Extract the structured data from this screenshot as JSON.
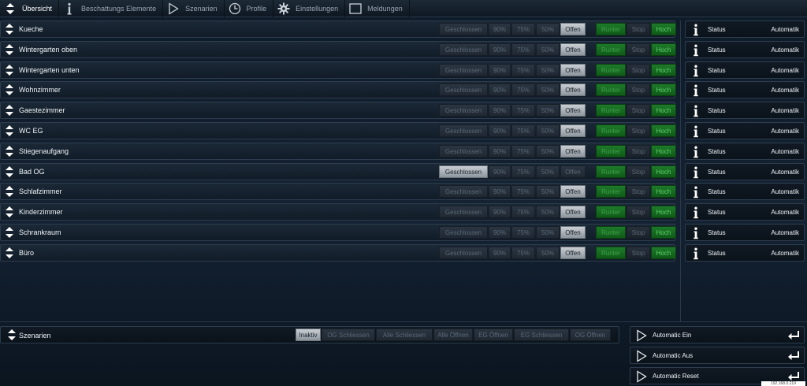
{
  "nav": {
    "items": [
      {
        "label": "Übersicht",
        "icon": "up-down-arrows-icon",
        "active": true
      },
      {
        "label": "Beschattungs Elemente",
        "icon": "info-icon",
        "active": false
      },
      {
        "label": "Szenarien",
        "icon": "play-icon",
        "active": false
      },
      {
        "label": "Profile",
        "icon": "clock-icon",
        "active": false
      },
      {
        "label": "Einstellungen",
        "icon": "gear-icon",
        "active": false
      },
      {
        "label": "Meldungen",
        "icon": "monitor-icon",
        "active": false
      }
    ]
  },
  "position_buttons": [
    "Geschlossen",
    "90%",
    "75%",
    "50%",
    "Offen"
  ],
  "move_buttons": [
    "Runter",
    "Stop",
    "Hoch"
  ],
  "rooms": [
    {
      "name": "Kueche",
      "selected": "Offen"
    },
    {
      "name": "Wintergarten oben",
      "selected": "Offen"
    },
    {
      "name": "Wintergarten unten",
      "selected": "Offen"
    },
    {
      "name": "Wohnzimmer",
      "selected": "Offen"
    },
    {
      "name": "Gaestezimmer",
      "selected": "Offen"
    },
    {
      "name": "WC EG",
      "selected": "Offen"
    },
    {
      "name": "Stiegenaufgang",
      "selected": "Offen"
    },
    {
      "name": "Bad OG",
      "selected": "Geschlossen"
    },
    {
      "name": "Schlafzimmer",
      "selected": "Offen"
    },
    {
      "name": "Kinderzimmer",
      "selected": "Offen"
    },
    {
      "name": "Schrankraum",
      "selected": "Offen"
    },
    {
      "name": "Büro",
      "selected": "Offen"
    }
  ],
  "status": {
    "label": "Status",
    "value": "Automatik"
  },
  "scenarios": {
    "title": "Szenarien",
    "buttons": [
      "Inaktiv",
      "OG Schliessen",
      "Alle Schliessen",
      "Alle Öffnen",
      "EG Öffnen",
      "EG Schliessen",
      "OG Öffnen"
    ],
    "selected": "Inaktiv"
  },
  "automatic": [
    {
      "label": "Automatic Ein"
    },
    {
      "label": "Automatic Aus"
    },
    {
      "label": "Automatic Reset"
    }
  ],
  "ip_badge": "192.168.0.219",
  "colors": {
    "accent_green": "#1f7a2a",
    "selected_button": "#b8bec4",
    "background": "#142233"
  }
}
